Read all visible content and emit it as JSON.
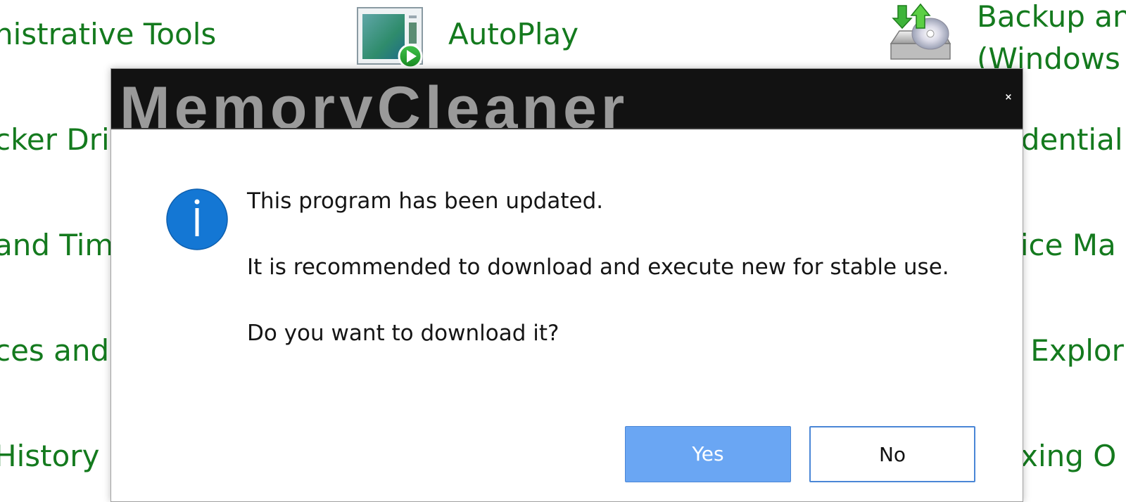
{
  "control_panel": {
    "items": [
      "nistrative Tools",
      "cker Dri",
      "and Tim",
      "ces and",
      "History",
      "AutoPlay",
      "Backup an\n(Windows",
      "edential",
      "vice Ma",
      "e Explor",
      "exing O"
    ],
    "icons": {
      "autoplay": "autoplay-icon",
      "backup": "backup-restore-icon"
    }
  },
  "dialog": {
    "title": "MemoryCleaner",
    "close_label": "×",
    "icon": "info-icon",
    "messages": [
      "This program has been updated.",
      "It is recommended to download and execute new for stable use.",
      "Do you want to download it?"
    ],
    "buttons": {
      "yes": "Yes",
      "no": "No"
    }
  },
  "colors": {
    "control_panel_text": "#147a1e",
    "title_bar_bg": "#121212",
    "title_text": "#9a9a9a",
    "info_icon": "#1477d4",
    "yes_button": "#6aa6f3",
    "button_border": "#4a86d6"
  }
}
